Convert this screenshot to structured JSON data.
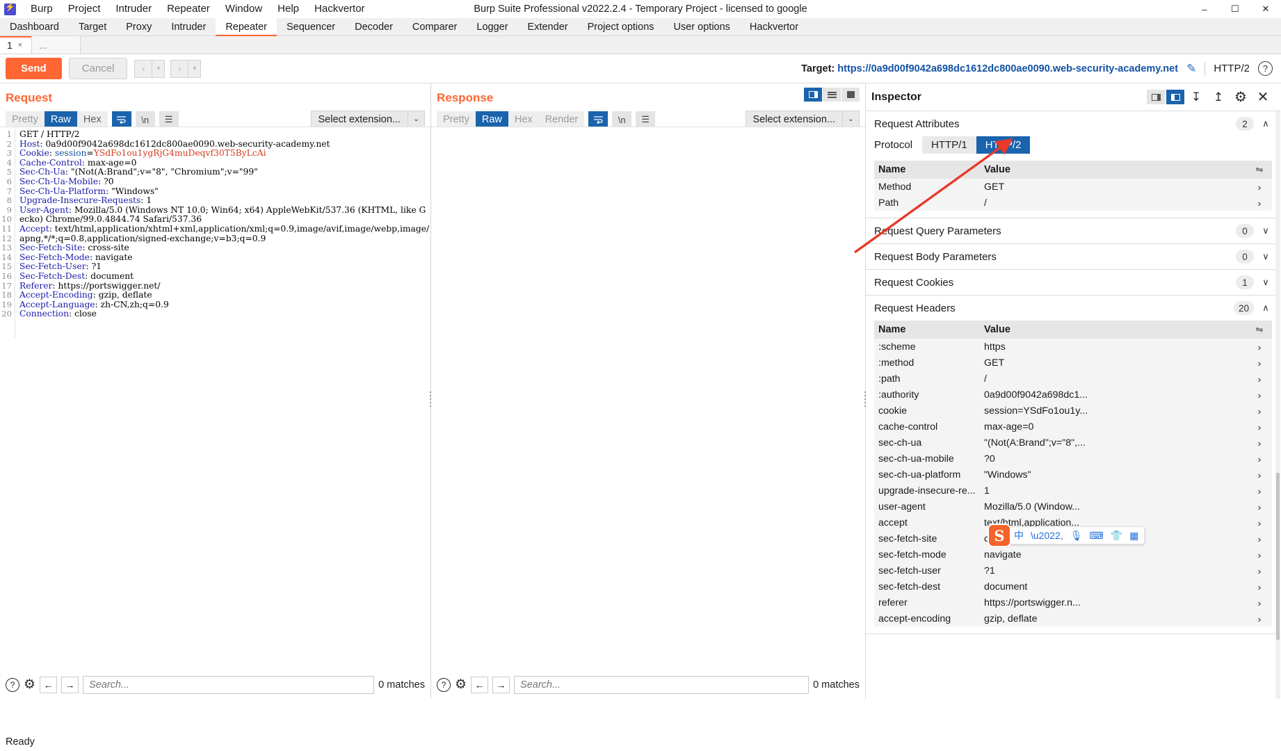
{
  "window": {
    "title": "Burp Suite Professional v2022.2.4 - Temporary Project - licensed to google",
    "minimize": "–",
    "maximize": "☐",
    "close": "✕"
  },
  "menubar": [
    "Burp",
    "Project",
    "Intruder",
    "Repeater",
    "Window",
    "Help",
    "Hackvertor"
  ],
  "main_tabs": [
    {
      "label": "Dashboard",
      "active": false
    },
    {
      "label": "Target",
      "active": false
    },
    {
      "label": "Proxy",
      "active": false
    },
    {
      "label": "Intruder",
      "active": false
    },
    {
      "label": "Repeater",
      "active": true
    },
    {
      "label": "Sequencer",
      "active": false
    },
    {
      "label": "Decoder",
      "active": false
    },
    {
      "label": "Comparer",
      "active": false
    },
    {
      "label": "Logger",
      "active": false
    },
    {
      "label": "Extender",
      "active": false
    },
    {
      "label": "Project options",
      "active": false
    },
    {
      "label": "User options",
      "active": false
    },
    {
      "label": "Hackvertor",
      "active": false
    }
  ],
  "sub_tabs": {
    "tab_label": "1",
    "tab_close": "×",
    "new_tab": "..."
  },
  "toolbar": {
    "send_label": "Send",
    "cancel_label": "Cancel",
    "back_label": "‹",
    "back_caret": "▾",
    "forward_label": "›",
    "forward_caret": "▾",
    "target_prefix": "Target: ",
    "target_url": "https://0a9d00f9042a698dc1612dc800ae0090.web-security-academy.net",
    "edit_icon": "✎",
    "protocol_label": "HTTP/2",
    "help_icon": "?"
  },
  "request": {
    "title": "Request",
    "view_tabs": [
      {
        "label": "Pretty",
        "active": false,
        "dim": true
      },
      {
        "label": "Raw",
        "active": true,
        "dim": false
      },
      {
        "label": "Hex",
        "active": false,
        "dim": false
      }
    ],
    "wrap_icon": "↩",
    "newline_label": "\\n",
    "menu_icon": "☰",
    "select_extension": "Select extension...",
    "select_caret": "⌄",
    "search_placeholder": "Search...",
    "matches": "0 matches",
    "search_prev": "←",
    "search_next": "→",
    "help_icon": "?",
    "gear_icon": "⚙",
    "lines": [
      {
        "n": "1",
        "segments": [
          {
            "t": "GET / HTTP/2",
            "c": "hv"
          }
        ]
      },
      {
        "n": "2",
        "segments": [
          {
            "t": "Host",
            "c": "hk"
          },
          {
            "t": ": 0a9d00f9042a698dc1612dc800ae0090.web-security-academy.net",
            "c": "hv"
          }
        ]
      },
      {
        "n": "3",
        "segments": [
          {
            "t": "Cookie",
            "c": "hk"
          },
          {
            "t": ": ",
            "c": "hv"
          },
          {
            "t": "session",
            "c": "hblue"
          },
          {
            "t": "=",
            "c": "hv"
          },
          {
            "t": "YSdFo1ou1ygRjG4muDeqvf30T5ByLcAi",
            "c": "hred"
          }
        ]
      },
      {
        "n": "4",
        "segments": [
          {
            "t": "Cache-Control",
            "c": "hk"
          },
          {
            "t": ": max-age=0",
            "c": "hv"
          }
        ]
      },
      {
        "n": "5",
        "segments": [
          {
            "t": "Sec-Ch-Ua",
            "c": "hk"
          },
          {
            "t": ": \"(Not(A:Brand\";v=\"8\", \"Chromium\";v=\"99\"",
            "c": "hv"
          }
        ]
      },
      {
        "n": "6",
        "segments": [
          {
            "t": "Sec-Ch-Ua-Mobile",
            "c": "hk"
          },
          {
            "t": ": ?0",
            "c": "hv"
          }
        ]
      },
      {
        "n": "7",
        "segments": [
          {
            "t": "Sec-Ch-Ua-Platform",
            "c": "hk"
          },
          {
            "t": ": \"Windows\"",
            "c": "hv"
          }
        ]
      },
      {
        "n": "8",
        "segments": [
          {
            "t": "Upgrade-Insecure-Requests",
            "c": "hk"
          },
          {
            "t": ": 1",
            "c": "hv"
          }
        ]
      },
      {
        "n": "9",
        "segments": [
          {
            "t": "User-Agent",
            "c": "hk"
          },
          {
            "t": ": Mozilla/5.0 (Windows NT 10.0; Win64; x64) AppleWebKit/537.36 (KHTML, like Gecko) Chrome/99.0.4844.74 Safari/537.36",
            "c": "hv"
          }
        ]
      },
      {
        "n": "10",
        "segments": [
          {
            "t": "Accept",
            "c": "hk"
          },
          {
            "t": ": text/html,application/xhtml+xml,application/xml;q=0.9,image/avif,image/webp,image/apng,*/*;q=0.8,application/signed-exchange;v=b3;q=0.9",
            "c": "hv"
          }
        ]
      },
      {
        "n": "11",
        "segments": [
          {
            "t": "Sec-Fetch-Site",
            "c": "hk"
          },
          {
            "t": ": cross-site",
            "c": "hv"
          }
        ]
      },
      {
        "n": "12",
        "segments": [
          {
            "t": "Sec-Fetch-Mode",
            "c": "hk"
          },
          {
            "t": ": navigate",
            "c": "hv"
          }
        ]
      },
      {
        "n": "13",
        "segments": [
          {
            "t": "Sec-Fetch-User",
            "c": "hk"
          },
          {
            "t": ": ?1",
            "c": "hv"
          }
        ]
      },
      {
        "n": "14",
        "segments": [
          {
            "t": "Sec-Fetch-Dest",
            "c": "hk"
          },
          {
            "t": ": document",
            "c": "hv"
          }
        ]
      },
      {
        "n": "15",
        "segments": [
          {
            "t": "Referer",
            "c": "hk"
          },
          {
            "t": ": https://portswigger.net/",
            "c": "hv"
          }
        ]
      },
      {
        "n": "16",
        "segments": [
          {
            "t": "Accept-Encoding",
            "c": "hk"
          },
          {
            "t": ": gzip, deflate",
            "c": "hv"
          }
        ]
      },
      {
        "n": "17",
        "segments": [
          {
            "t": "Accept-Language",
            "c": "hk"
          },
          {
            "t": ": zh-CN,zh;q=0.9",
            "c": "hv"
          }
        ]
      },
      {
        "n": "18",
        "segments": [
          {
            "t": "Connection",
            "c": "hk"
          },
          {
            "t": ": close",
            "c": "hv"
          }
        ]
      },
      {
        "n": "19",
        "segments": []
      },
      {
        "n": "20",
        "segments": []
      }
    ]
  },
  "response": {
    "title": "Response",
    "view_tabs": [
      {
        "label": "Pretty",
        "active": false,
        "dim": true
      },
      {
        "label": "Raw",
        "active": true,
        "dim": false
      },
      {
        "label": "Hex",
        "active": false,
        "dim": true
      },
      {
        "label": "Render",
        "active": false,
        "dim": true
      }
    ],
    "wrap_icon": "↩",
    "newline_label": "\\n",
    "menu_icon": "☰",
    "select_extension": "Select extension...",
    "select_caret": "⌄",
    "search_placeholder": "Search...",
    "matches": "0 matches",
    "search_prev": "←",
    "search_next": "→",
    "help_icon": "?",
    "gear_icon": "⚙",
    "layout_buttons": [
      "split-vertical-icon",
      "split-horizontal-icon",
      "maximize-icon"
    ]
  },
  "inspector": {
    "title": "Inspector",
    "header_icons": [
      "dock-left-icon",
      "dock-right-icon",
      "expand-all-icon",
      "collapse-all-icon",
      "gear-icon",
      "close-icon"
    ],
    "gear_icon": "⚙",
    "close_icon": "✕",
    "expand_icon": "↧",
    "collapse_icon": "↥",
    "sections": [
      {
        "name": "Request Attributes",
        "count": "2",
        "expanded": true,
        "chevron": "∧"
      },
      {
        "name": "Request Query Parameters",
        "count": "0",
        "expanded": false,
        "chevron": "∨"
      },
      {
        "name": "Request Body Parameters",
        "count": "0",
        "expanded": false,
        "chevron": "∨"
      },
      {
        "name": "Request Cookies",
        "count": "1",
        "expanded": false,
        "chevron": "∨"
      },
      {
        "name": "Request Headers",
        "count": "20",
        "expanded": true,
        "chevron": "∧"
      }
    ],
    "protocol": {
      "label": "Protocol",
      "options": [
        "HTTP/1",
        "HTTP/2"
      ],
      "selected": "HTTP/2"
    },
    "attributes_table": {
      "columns": [
        "Name",
        "Value"
      ],
      "sort_icon": "⇋",
      "rows": [
        {
          "name": "Method",
          "value": "GET",
          "chevron": "›"
        },
        {
          "name": "Path",
          "value": "/",
          "chevron": "›"
        }
      ]
    },
    "headers_table": {
      "columns": [
        "Name",
        "Value"
      ],
      "sort_icon": "⇋",
      "rows": [
        {
          "name": ":scheme",
          "value": "https",
          "chevron": "›"
        },
        {
          "name": ":method",
          "value": "GET",
          "chevron": "›"
        },
        {
          "name": ":path",
          "value": "/",
          "chevron": "›"
        },
        {
          "name": ":authority",
          "value": "0a9d00f9042a698dc1...",
          "chevron": "›"
        },
        {
          "name": "cookie",
          "value": "session=YSdFo1ou1y...",
          "chevron": "›"
        },
        {
          "name": "cache-control",
          "value": "max-age=0",
          "chevron": "›"
        },
        {
          "name": "sec-ch-ua",
          "value": "\"(Not(A:Brand\";v=\"8\",...",
          "chevron": "›"
        },
        {
          "name": "sec-ch-ua-mobile",
          "value": "?0",
          "chevron": "›"
        },
        {
          "name": "sec-ch-ua-platform",
          "value": "\"Windows\"",
          "chevron": "›"
        },
        {
          "name": "upgrade-insecure-re...",
          "value": "1",
          "chevron": "›"
        },
        {
          "name": "user-agent",
          "value": "Mozilla/5.0 (Window...",
          "chevron": "›"
        },
        {
          "name": "accept",
          "value": "text/html,application...",
          "chevron": "›"
        },
        {
          "name": "sec-fetch-site",
          "value": "cross-site",
          "chevron": "›"
        },
        {
          "name": "sec-fetch-mode",
          "value": "navigate",
          "chevron": "›"
        },
        {
          "name": "sec-fetch-user",
          "value": "?1",
          "chevron": "›"
        },
        {
          "name": "sec-fetch-dest",
          "value": "document",
          "chevron": "›"
        },
        {
          "name": "referer",
          "value": "https://portswigger.n...",
          "chevron": "›"
        },
        {
          "name": "accept-encoding",
          "value": "gzip, deflate",
          "chevron": "›"
        }
      ]
    }
  },
  "ime_toolbar": {
    "logo": "S",
    "icons": [
      "中",
      "•,",
      "🎙",
      "⌨",
      "👕",
      "☷"
    ]
  },
  "statusbar": {
    "text": "Ready"
  },
  "colors": {
    "accent_orange": "#ff6633",
    "accent_blue": "#1a63ad",
    "annotation_red": "#e8392a",
    "link_blue": "#1452a6"
  }
}
